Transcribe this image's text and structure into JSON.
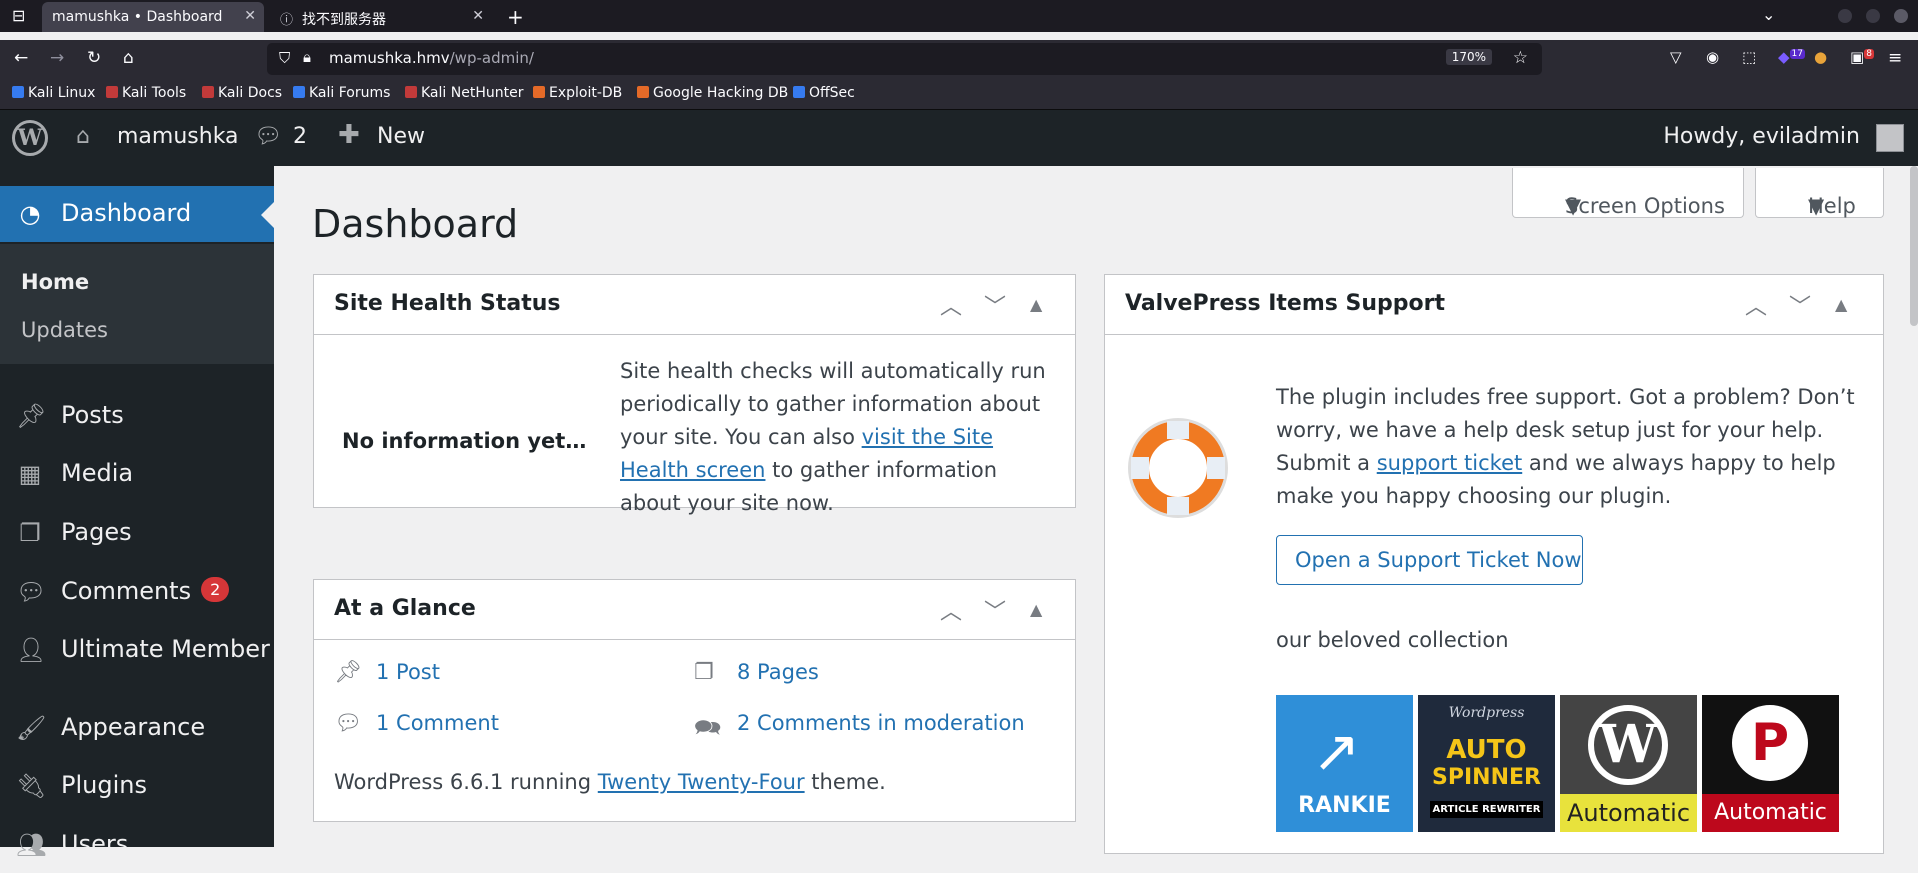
{
  "browser": {
    "tabs": [
      {
        "title": "mamushka • Dashboard",
        "close": "✕"
      },
      {
        "title": "找不到服务器",
        "close": "✕"
      }
    ],
    "new_tab": "+",
    "url_host": "mamushka.hmv",
    "url_path": "/wp-admin/",
    "zoom": "170%",
    "bookmarks": [
      "Kali Linux",
      "Kali Tools",
      "Kali Docs",
      "Kali Forums",
      "Kali NetHunter",
      "Exploit-DB",
      "Google Hacking DB",
      "OffSec"
    ],
    "ext_badges": [
      "17",
      "8"
    ]
  },
  "adminbar": {
    "site_name": "mamushka",
    "comments_count": "2",
    "new_label": "New",
    "howdy": "Howdy, eviladmin"
  },
  "sidebar": {
    "dashboard": "Dashboard",
    "sub_home": "Home",
    "sub_updates": "Updates",
    "items": [
      "Posts",
      "Media",
      "Pages",
      "Comments",
      "Ultimate Member",
      "Appearance",
      "Plugins",
      "Users"
    ],
    "comments_badge": "2"
  },
  "main": {
    "title": "Dashboard",
    "screen_options": "Screen Options",
    "help": "Help",
    "site_health": {
      "title": "Site Health Status",
      "status": "No information yet…",
      "text1": "Site health checks will automatically run periodically to gather information about your site. You can also",
      "link": "visit the Site Health screen",
      "text2": "to gather information about your site now."
    },
    "glance": {
      "title": "At a Glance",
      "posts": "1 Post",
      "pages": "8 Pages",
      "comments": "1 Comment",
      "moderation": "2 Comments in moderation",
      "wp_prefix": "WordPress 6.6.1 running",
      "theme": "Twenty Twenty-Four",
      "wp_suffix": "theme."
    },
    "valvepress": {
      "title": "ValvePress Items Support",
      "text1": "The plugin includes free support. Got a problem? Don’t worry, we have a help desk setup just for your help. Submit a",
      "link": "support ticket",
      "text2": "and we always happy to help make you happy choosing our plugin.",
      "button": "Open a Support Ticket Now",
      "collection": "our beloved collection",
      "tiles": [
        "RANKIE",
        "Wordpress",
        "AUTO",
        "SPINNER",
        "ARTICLE REWRITER",
        "Automatic",
        "Automatic"
      ]
    }
  },
  "colors": {
    "wp_blue": "#2271b1",
    "admin_dark": "#1d2327",
    "badge_red": "#d63638"
  }
}
